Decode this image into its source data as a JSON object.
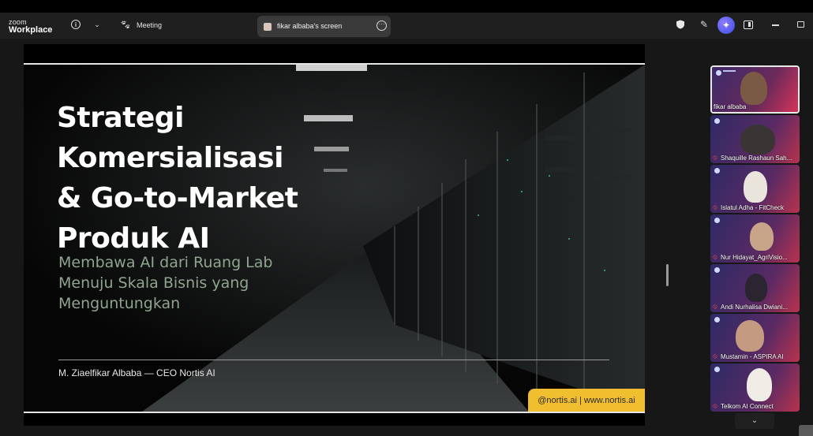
{
  "app": {
    "logo_line1": "zoom",
    "logo_line2": "Workplace"
  },
  "toolbar": {
    "meeting_label": "Meeting",
    "screen_tab_label": "fikar albaba's screen",
    "accent_ai": "#5b5ef0"
  },
  "icons": [
    "info-icon",
    "chevron-down-icon",
    "paw-icon",
    "more-icon",
    "shield-icon",
    "pen-icon",
    "ai-sparkle-icon",
    "panel-icon",
    "minimize-icon",
    "restore-icon",
    "mic-muted-icon"
  ],
  "slide": {
    "title": "Strategi\nKomersialisasi\n& Go-to-Market\nProduk AI",
    "subtitle": "Membawa AI dari Ruang Lab\nMenuju Skala Bisnis yang\nMenguntungkan",
    "author": "M. Ziaelfikar Albaba — CEO Nortis AI",
    "badge": "@nortis.ai | www.nortis.ai",
    "badge_color": "#f0be2e",
    "subtitle_color": "#8fa58f"
  },
  "participants": [
    {
      "name": "fikar albaba",
      "muted": false,
      "active": true
    },
    {
      "name": "Shaquille Rashaun Sah...",
      "muted": true,
      "active": false
    },
    {
      "name": "Islatul Adha - FitCheck",
      "muted": true,
      "active": false
    },
    {
      "name": "Nur Hidayat_AgriVisio...",
      "muted": true,
      "active": false
    },
    {
      "name": "Andi Nurhalisa Dwiani...",
      "muted": true,
      "active": false
    },
    {
      "name": "Mustamin - ASPIRA AI",
      "muted": true,
      "active": false
    },
    {
      "name": "Telkom AI Connect",
      "muted": true,
      "active": false
    }
  ]
}
